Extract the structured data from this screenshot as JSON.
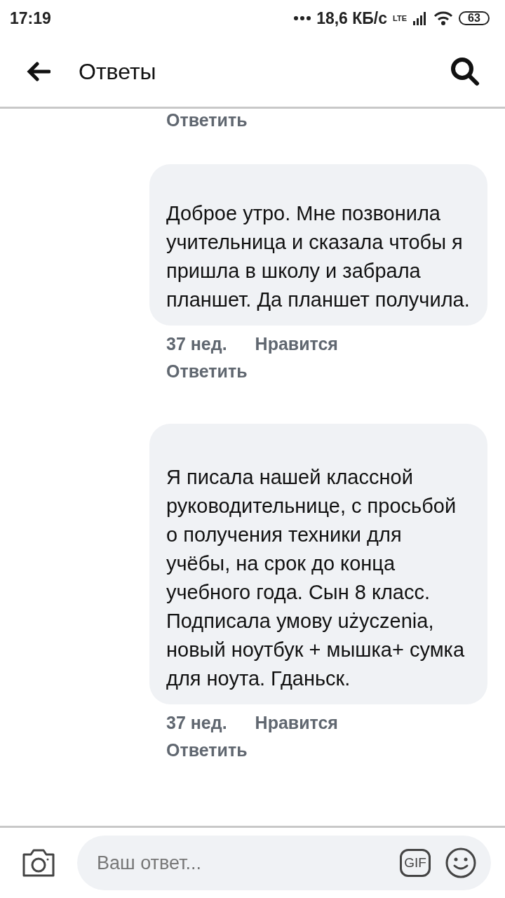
{
  "status_bar": {
    "time": "17:19",
    "speed": "18,6 КБ/с",
    "network": "LTE",
    "battery": "63"
  },
  "header": {
    "title": "Ответы"
  },
  "top_reply_link": "Ответить",
  "comments": [
    {
      "text": "Доброе утро. Мне позвонила учительница и сказала чтобы я пришла в школу и забрала планшет. Да планшет получила.",
      "age": "37 нед.",
      "like": "Нравится",
      "reply": "Ответить"
    },
    {
      "text": "Я писала нашей классной руководительнице, с просьбой о получения техники для учёбы, на срок до конца учебного года. Сын 8 класс. Подписала умову użyczenia, новый ноутбук + мышка+ сумка для ноута. Гданьск.",
      "age": "37 нед.",
      "like": "Нравится",
      "reply": "Ответить"
    }
  ],
  "composer": {
    "placeholder": "Ваш ответ...",
    "gif": "GIF"
  }
}
